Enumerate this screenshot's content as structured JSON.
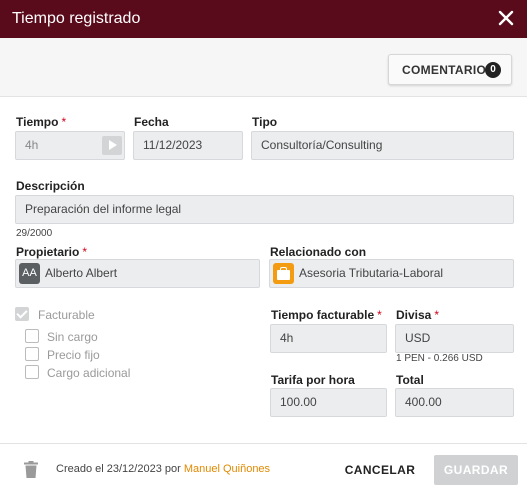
{
  "header": {
    "title": "Tiempo registrado"
  },
  "toolbar": {
    "comment_label": "COMENTARIO",
    "comment_count": "0"
  },
  "form": {
    "tiempo": {
      "label": "Tiempo",
      "required_mark": "*",
      "value": "4h"
    },
    "fecha": {
      "label": "Fecha",
      "value": "11/12/2023"
    },
    "tipo": {
      "label": "Tipo",
      "value": "Consultoría/Consulting"
    },
    "descripcion": {
      "label": "Descripción",
      "value": "Preparación del informe legal",
      "counter": "29/2000"
    },
    "propietario": {
      "label": "Propietario",
      "required_mark": "*",
      "avatar": "AA",
      "value": "Alberto Albert"
    },
    "relacionado": {
      "label": "Relacionado con",
      "icon": "briefcase-icon",
      "value": "Asesoria Tributaria-Laboral"
    },
    "facturable": {
      "label": "Facturable",
      "checked": true
    },
    "sin_cargo": {
      "label": "Sin cargo",
      "checked": false
    },
    "precio_fijo": {
      "label": "Precio fijo",
      "checked": false
    },
    "cargo_adicional": {
      "label": "Cargo adicional",
      "checked": false
    },
    "tiempo_facturable": {
      "label": "Tiempo facturable",
      "required_mark": "*",
      "value": "4h"
    },
    "divisa": {
      "label": "Divisa",
      "required_mark": "*",
      "value": "USD",
      "rate": "1 PEN - 0.266 USD"
    },
    "tarifa": {
      "label": "Tarifa por hora",
      "value": "100.00"
    },
    "total": {
      "label": "Total",
      "value": "400.00"
    }
  },
  "footer": {
    "created_prefix": "Creado el 23/12/2023 por",
    "created_user": "Manuel Quiñones",
    "cancel_label": "CANCELAR",
    "save_label": "GUARDAR"
  },
  "colors": {
    "header_bg": "#5a0b1b",
    "accent_link": "#e08a00",
    "required": "#d0021b"
  }
}
